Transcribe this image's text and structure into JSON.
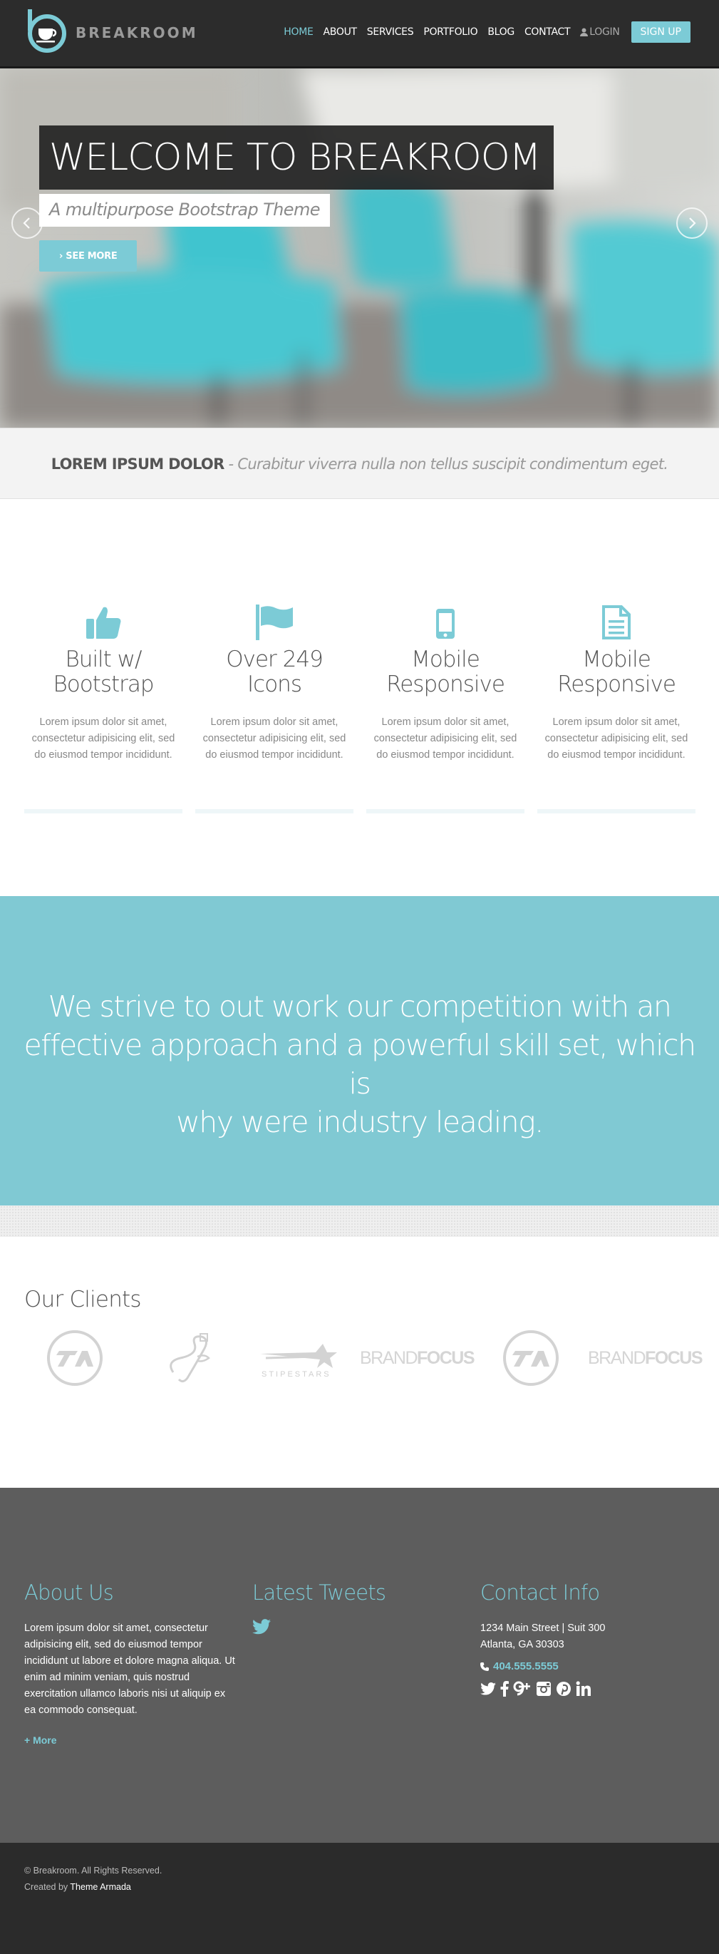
{
  "brand": {
    "name": "BREAKROOM",
    "accent": "#7ccbd6"
  },
  "nav": {
    "items": [
      {
        "label": "HOME",
        "active": true
      },
      {
        "label": "ABOUT",
        "active": false
      },
      {
        "label": "SERVICES",
        "active": false
      },
      {
        "label": "PORTFOLIO",
        "active": false
      },
      {
        "label": "BLOG",
        "active": false
      },
      {
        "label": "CONTACT",
        "active": false
      }
    ],
    "login": "LOGIN",
    "signup": "SIGN UP"
  },
  "hero": {
    "title": "WELCOME TO BREAKROOM",
    "subtitle": "A multipurpose Bootstrap Theme",
    "button": "SEE MORE"
  },
  "tagline": {
    "strong": "LOREM IPSUM DOLOR",
    "separator": " - ",
    "em": "Curabitur viverra nulla non tellus suscipit condimentum eget."
  },
  "features": [
    {
      "icon": "thumbs-up-icon",
      "title_line1": "Built w/",
      "title_line2": "Bootstrap",
      "text": "Lorem ipsum dolor sit amet, consectetur adipisicing elit, sed do eiusmod tempor incididunt."
    },
    {
      "icon": "flag-icon",
      "title_line1": "Over 249",
      "title_line2": "Icons",
      "text": "Lorem ipsum dolor sit amet, consectetur adipisicing elit, sed do eiusmod tempor incididunt."
    },
    {
      "icon": "mobile-icon",
      "title_line1": "Mobile",
      "title_line2": "Responsive",
      "text": "Lorem ipsum dolor sit amet, consectetur adipisicing elit, sed do eiusmod tempor incididunt."
    },
    {
      "icon": "document-icon",
      "title_line1": "Mobile",
      "title_line2": "Responsive",
      "text": "Lorem ipsum dolor sit amet, consectetur adipisicing elit, sed do eiusmod tempor incididunt."
    }
  ],
  "quote": {
    "line1": "We strive to out work our competition with an",
    "line2": "effective approach and a powerful skill set, which is",
    "line3": "why were industry leading."
  },
  "clients": {
    "title": "Our Clients",
    "logos": [
      {
        "name": "TA",
        "kind": "circle-badge"
      },
      {
        "name": "signature",
        "kind": "script"
      },
      {
        "name": "STIPESTARS",
        "kind": "star"
      },
      {
        "name_light": "BRAND",
        "name_bold": "FOCUS",
        "kind": "wordmark"
      },
      {
        "name": "TA",
        "kind": "circle-badge"
      },
      {
        "name_light": "BRAND",
        "name_bold": "FOCUS",
        "kind": "wordmark"
      }
    ]
  },
  "footer": {
    "about": {
      "heading": "About Us",
      "text": "Lorem ipsum dolor sit amet, consectetur adipisicing elit, sed do eiusmod tempor incididunt ut labore et dolore magna aliqua. Ut enim ad minim veniam, quis nostrud exercitation ullamco laboris nisi ut aliquip ex ea commodo consequat.",
      "more": "+ More"
    },
    "tweets": {
      "heading": "Latest Tweets"
    },
    "contact": {
      "heading": "Contact Info",
      "address_line1": "1234 Main Street | Suit 300",
      "address_line2": "Atlanta, GA 30303",
      "phone": "404.555.5555",
      "social": [
        "twitter-icon",
        "facebook-icon",
        "google-plus-icon",
        "instagram-icon",
        "pinterest-icon",
        "linkedin-icon"
      ]
    }
  },
  "bottom": {
    "copyright": "© Breakroom. All Rights Reserved.",
    "created_prefix": "Created by ",
    "created_by": "Theme Armada"
  }
}
